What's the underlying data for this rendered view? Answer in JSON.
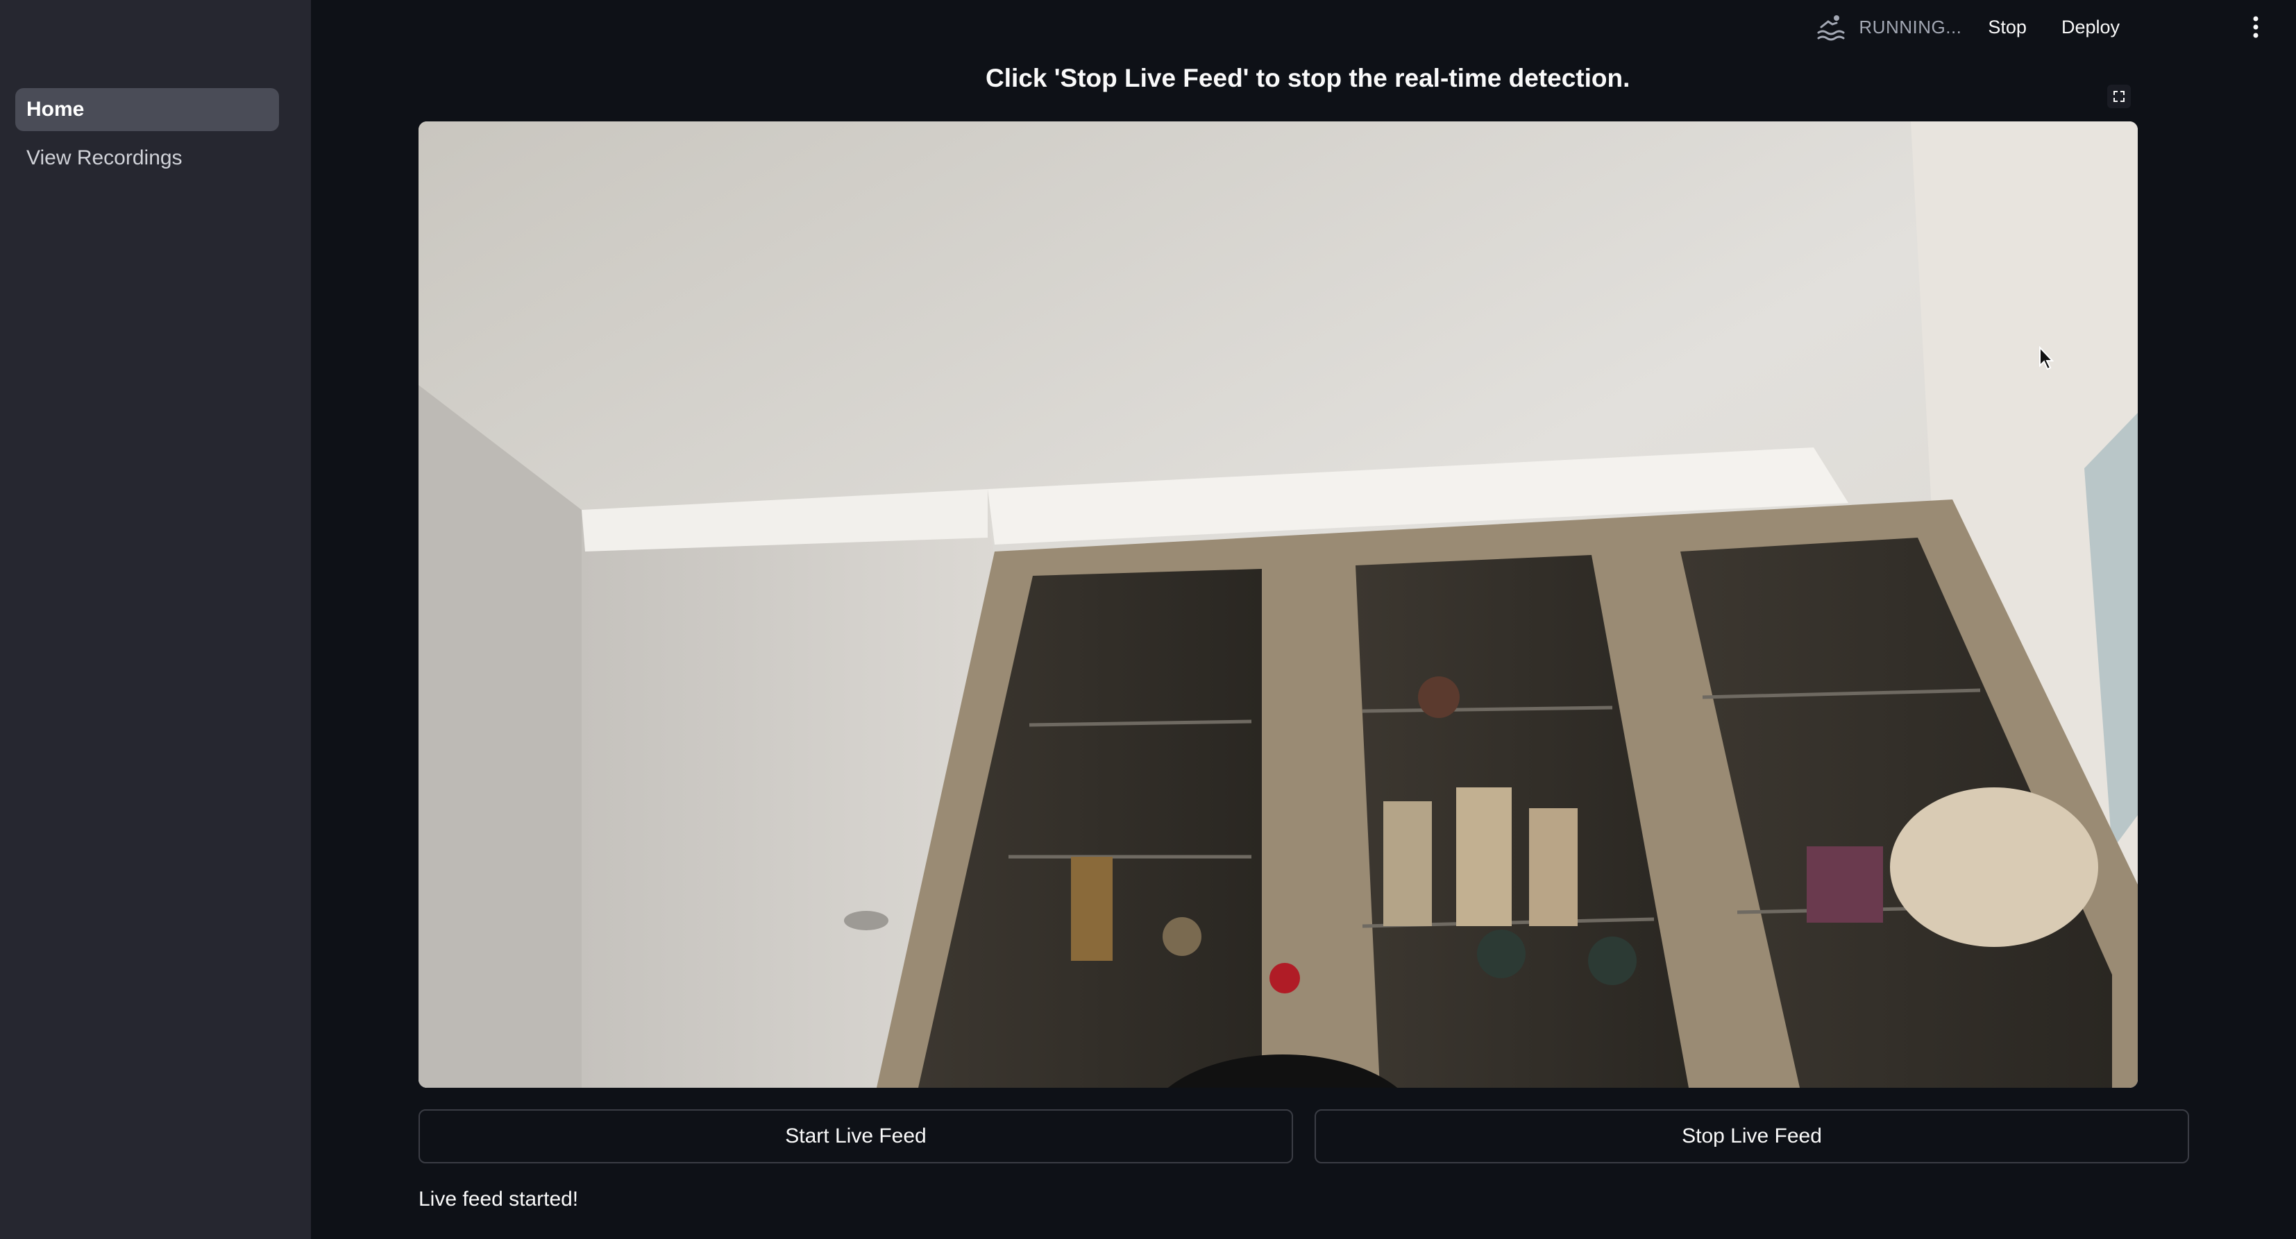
{
  "sidebar": {
    "items": [
      {
        "label": "Home",
        "active": true
      },
      {
        "label": "View Recordings",
        "active": false
      }
    ]
  },
  "header": {
    "status_icon": "swimmer-running-icon",
    "status_text": "RUNNING...",
    "stop_label": "Stop",
    "deploy_label": "Deploy",
    "menu_icon": "kebab-menu-icon"
  },
  "main": {
    "instruction": "Click 'Stop Live Feed' to stop the real-time detection.",
    "fullscreen_icon": "fullscreen-icon",
    "video_feed": "live-camera-feed",
    "start_button": "Start Live Feed",
    "stop_button": "Stop Live Feed",
    "status_message": "Live feed started!"
  },
  "colors": {
    "app_background": "#0e1117",
    "sidebar_background": "#262730",
    "active_nav": "#4a4c57",
    "text": "#fafafa",
    "muted_text": "#a3a8b4",
    "button_border": "#3b3d45"
  }
}
